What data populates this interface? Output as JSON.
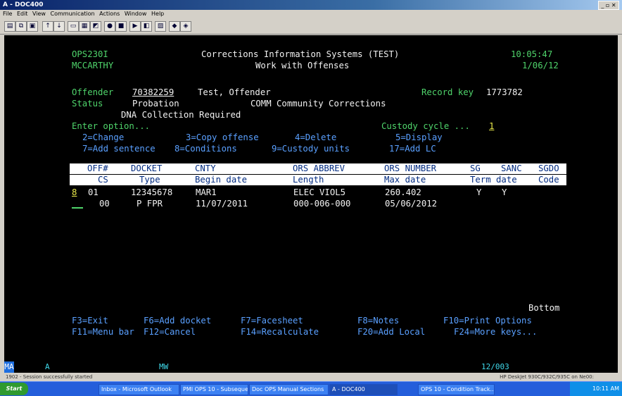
{
  "window": {
    "title": "A - DOC400",
    "controls": "_ ▫ ✕"
  },
  "menu": [
    "File",
    "Edit",
    "View",
    "Communication",
    "Actions",
    "Window",
    "Help"
  ],
  "toolbar_icons": [
    "print-icon",
    "copy-icon",
    "paste-icon",
    "send-icon",
    "receive-icon",
    "display-icon",
    "color-icon",
    "map-icon",
    "record-icon",
    "stop-icon",
    "play-icon",
    "macro-icon",
    "clipboard-icon",
    "support-icon",
    "color-palette-icon"
  ],
  "screen": {
    "program_id": "OPS230I",
    "user_id": "MCCARTHY",
    "system_title": "Corrections Information Systems (TEST)",
    "screen_title": "Work with Offenses",
    "time": "10:05:47",
    "date": "1/06/12",
    "offender_label": "Offender",
    "offender_number": "70382259",
    "offender_name": "Test, Offender",
    "record_key_label": "Record key",
    "record_key": "1773782",
    "status_label": "Status",
    "status_value": "Probation",
    "agency_value": "COMM Community Corrections",
    "dna_notice": "DNA Collection Required",
    "enter_option": "Enter option...",
    "custody_cycle_label": "Custody cycle ...",
    "custody_cycle_value": "1",
    "options_line1": [
      "2=Change",
      "3=Copy offense",
      "4=Delete",
      "5=Display"
    ],
    "options_line2": [
      "7=Add sentence",
      "8=Conditions",
      "9=Custody units",
      "17=Add LC"
    ],
    "header_row1": [
      "OFF#",
      "DOCKET",
      "CNTY",
      "ORS ABBREV",
      "ORS NUMBER",
      "SG",
      "SANC",
      "SGDO"
    ],
    "header_row2": [
      "CS",
      "Type",
      "Begin date",
      "Length",
      "Max date",
      "Term date",
      "Code"
    ],
    "record_row1": {
      "option": "8",
      "off": "01",
      "docket": "12345678",
      "cnty": "MAR1",
      "ors_abbrev": "ELEC VIOL5",
      "ors_number": "260.402",
      "sg": "Y",
      "sanc": "Y"
    },
    "record_row2": {
      "cs": "00",
      "type": "P FPR",
      "begin_date": "11/07/2011",
      "length": "000-006-000",
      "max_date": "05/06/2012"
    },
    "bottom": "Bottom",
    "fkeys_line1": [
      "F3=Exit",
      "F6=Add docket",
      "F7=Facesheet",
      "F8=Notes",
      "F10=Print Options"
    ],
    "fkeys_line2": [
      "F11=Menu bar",
      "F12=Cancel",
      "F14=Recalculate",
      "F20=Add Local",
      "F24=More keys..."
    ]
  },
  "statusbar": {
    "session": "MA",
    "indicator": "A",
    "mode": "MW",
    "cursor_pos": "12/003"
  },
  "message": {
    "left": "1902 - Session successfully started",
    "right": "HP DeskJet 930C/932C/935C on Ne00:"
  },
  "taskbar": {
    "start": "Start",
    "tasks": [
      "Inbox - Microsoft Outlook",
      "PMI OPS 10 - Subsequen...",
      "Doc OPS Manual Sections",
      "A - DOC400",
      "OPS 10 - Condition Track..."
    ],
    "clock": "10:11 AM"
  },
  "colors": {
    "terminal_bg": "#000000",
    "green": "#4fd46b",
    "white": "#f2f2f2",
    "cyan": "#3fd7e8",
    "blue": "#5aa0ff",
    "yellow": "#e8e84a",
    "header_band": "#ffffff"
  }
}
